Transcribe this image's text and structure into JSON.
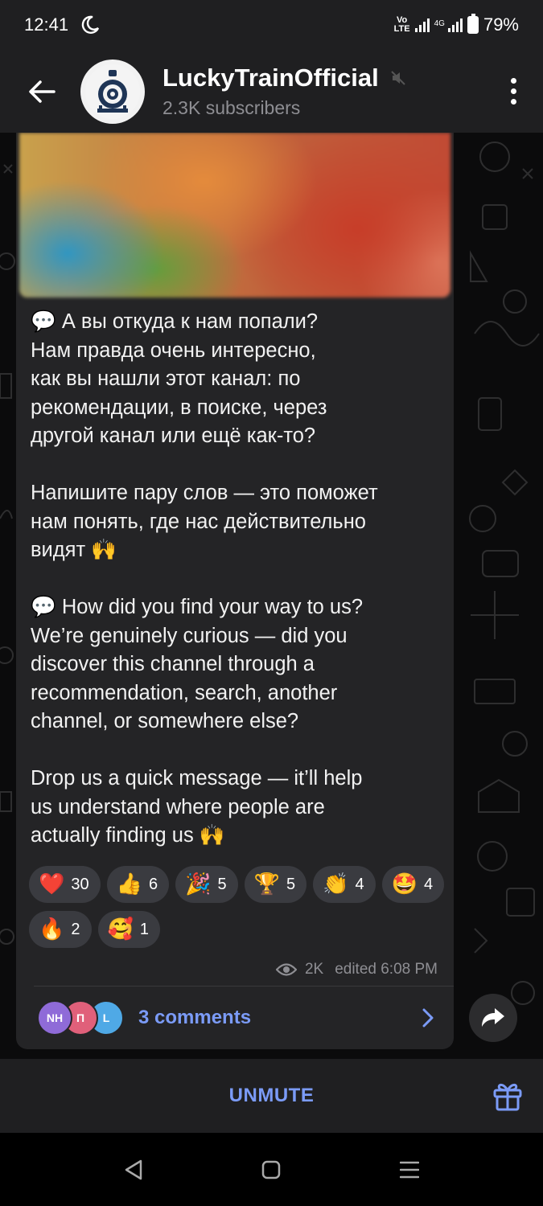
{
  "status_bar": {
    "time": "12:41",
    "volte_top": "Vo",
    "volte_bottom": "LTE",
    "network": "4G",
    "battery": "79%"
  },
  "header": {
    "channel_name": "LuckyTrainOfficial",
    "subscribers": "2.3K subscribers",
    "icons": [
      "back-arrow-icon",
      "muted-speaker-icon",
      "more-vertical-icon"
    ]
  },
  "message": {
    "text": "💬 А вы откуда к нам попали?\nНам правда очень интересно,\nкак вы нашли этот канал: по\nрекомендации, в поиске, через\nдругой канал или ещё как-то?\n\nНапишите пару слов — это поможет\nнам понять, где нас действительно\nвидят 🙌\n\n💬 How did you find your way to us?\nWe’re genuinely curious — did you\ndiscover this channel through a\nrecommendation, search, another\nchannel, or somewhere else?\n\nDrop us a quick message — it’ll help\nus understand where people are\nactually finding us 🙌",
    "reactions": [
      {
        "emoji": "❤️",
        "count": "30"
      },
      {
        "emoji": "👍",
        "count": "6"
      },
      {
        "emoji": "🎉",
        "count": "5"
      },
      {
        "emoji": "🏆",
        "count": "5"
      },
      {
        "emoji": "👏",
        "count": "4"
      },
      {
        "emoji": "🤩",
        "count": "4"
      },
      {
        "emoji": "🔥",
        "count": "2"
      },
      {
        "emoji": "🥰",
        "count": "1"
      }
    ],
    "views": "2K",
    "edited": "edited 6:08 PM"
  },
  "comments": {
    "avatars": [
      {
        "initials": "NH",
        "color": "#8f6bd8"
      },
      {
        "initials": "П",
        "color": "#e0607a"
      },
      {
        "initials": "L",
        "color": "#4fa9e6"
      }
    ],
    "label": "3 comments"
  },
  "bottom_bar": {
    "unmute_label": "UNMUTE"
  },
  "colors": {
    "accent": "#7b9bf7",
    "bubble": "#242426",
    "header": "#1f1f21"
  }
}
